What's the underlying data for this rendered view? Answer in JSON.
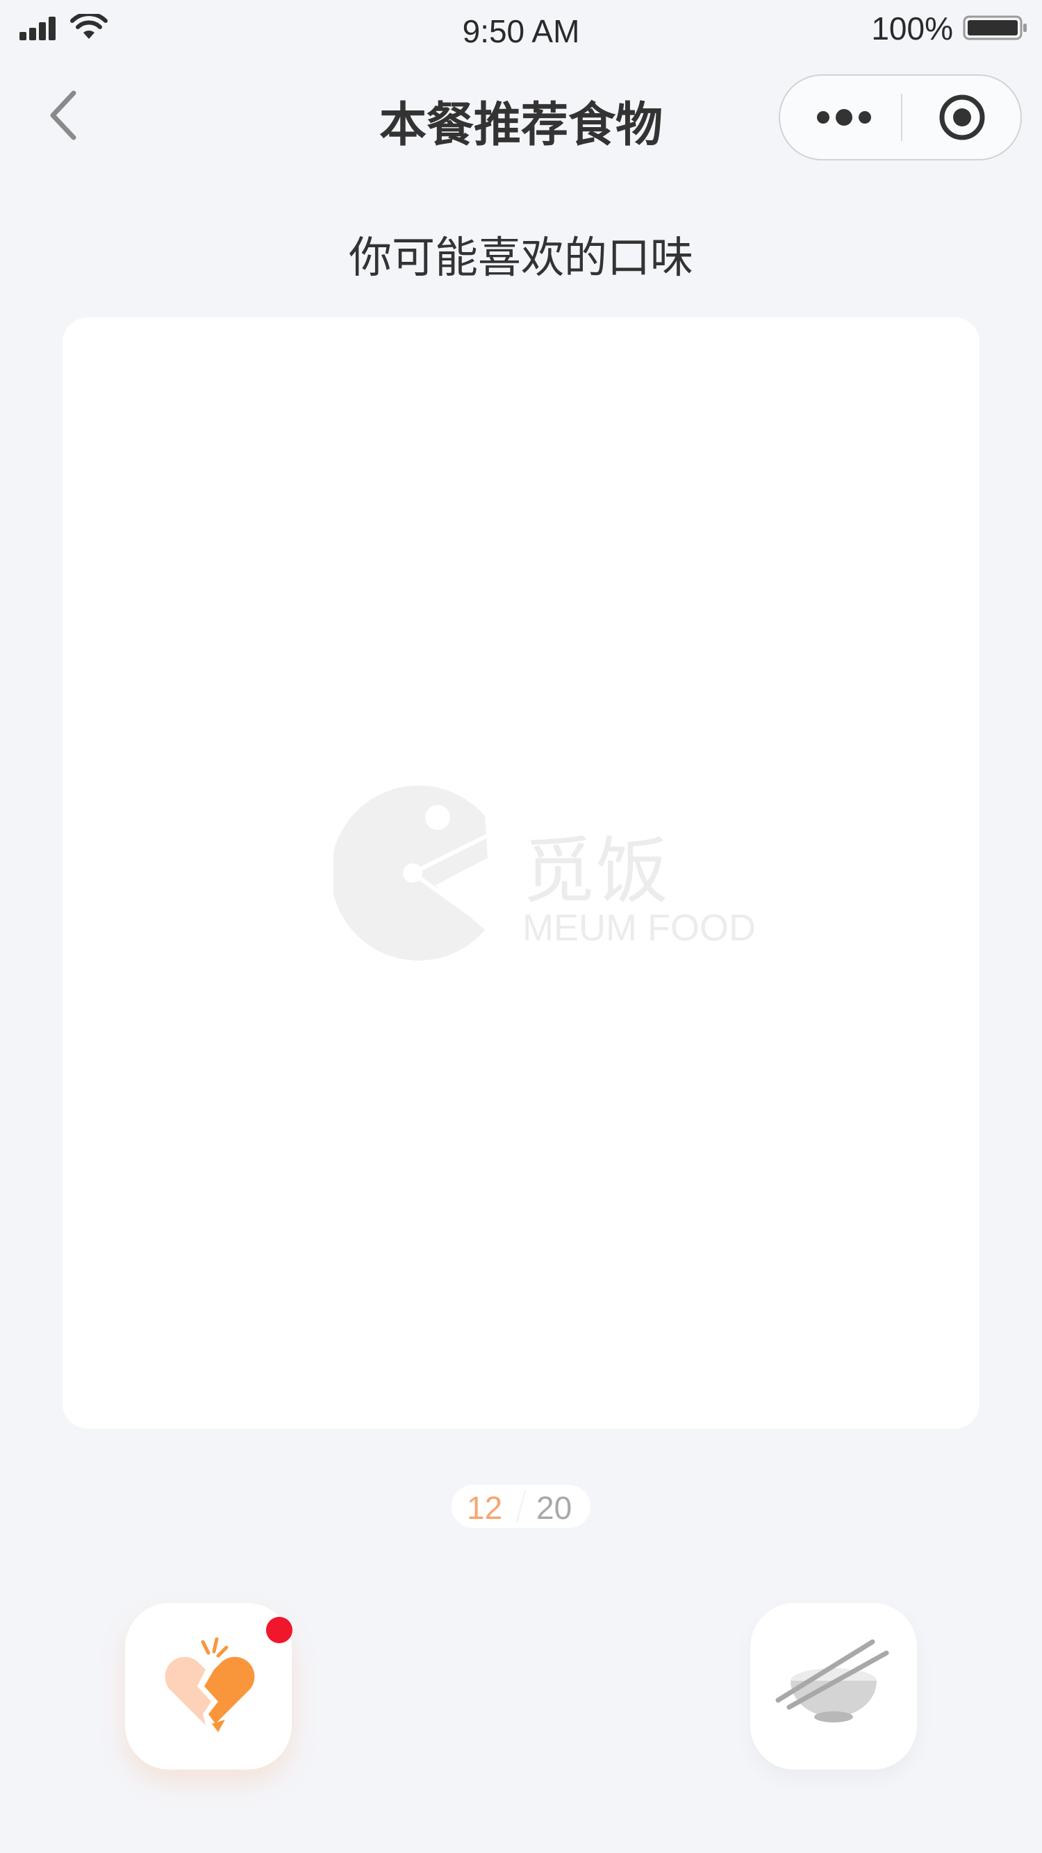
{
  "status_bar": {
    "time": "9:50 AM",
    "battery": "100%"
  },
  "nav": {
    "title": "本餐推荐食物"
  },
  "section": {
    "heading": "你可能喜欢的口味"
  },
  "card": {
    "placeholder_brand_cn": "觅饭",
    "placeholder_brand_en": "MEUM FOOD"
  },
  "pager": {
    "current": "12",
    "total": "20"
  },
  "colors": {
    "background": "#f4f5f9",
    "accent_orange": "#f6a671",
    "badge_red": "#f0162b",
    "text_dark": "#333333"
  },
  "icons": {
    "back": "chevron-left-icon",
    "more": "more-dots-icon",
    "close": "target-circle-icon",
    "dislike": "broken-heart-icon",
    "eat": "bowl-chopsticks-icon"
  }
}
